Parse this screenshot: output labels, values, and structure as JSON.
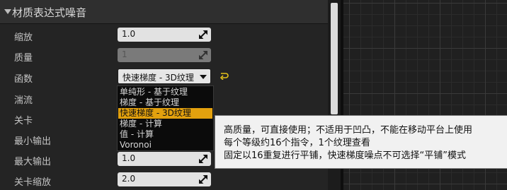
{
  "panel": {
    "title": "材质表达式噪音"
  },
  "properties": {
    "scale": {
      "label": "缩放",
      "value": "1.0"
    },
    "quality": {
      "label": "质量",
      "value": "1"
    },
    "function": {
      "label": "函数",
      "value": "快速梯度 - 3D纹理"
    },
    "turbulence": {
      "label": "湍流"
    },
    "levels": {
      "label": "关卡"
    },
    "output_min": {
      "label": "最小输出"
    },
    "output_max": {
      "label": "最大输出",
      "value": "1.0"
    },
    "level_scale": {
      "label": "关卡缩放",
      "value": "2.0"
    }
  },
  "function_options": [
    {
      "label": "单纯形 - 基于纹理",
      "selected": false
    },
    {
      "label": "梯度 - 基于纹理",
      "selected": false
    },
    {
      "label": "快速梯度 - 3D纹理",
      "selected": true
    },
    {
      "label": "梯度 - 计算",
      "selected": false
    },
    {
      "label": "值 - 计算",
      "selected": false
    },
    {
      "label": "Voronoi",
      "selected": false
    }
  ],
  "tooltip": {
    "line1": "高质量，可直接使用；不适用于凹凸，不能在移动平台上使用",
    "line2": "每个等级约16个指令，1个纹理查看",
    "line3": "固定以16重复进行平铺，快速梯度噪点不可选择“平铺”模式"
  },
  "icons": {
    "collapse": "triangle-down-icon",
    "drag": "drag-arrows-icon",
    "reset": "reset-arrow-icon"
  },
  "colors": {
    "selected_item": "#e3a10e",
    "reset_icon": "#e5c21a"
  }
}
